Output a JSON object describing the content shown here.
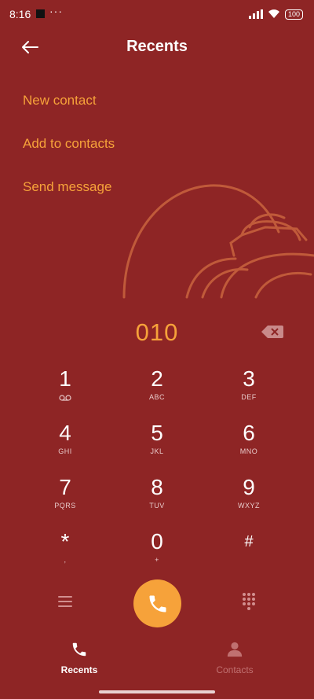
{
  "status_bar": {
    "time": "8:16",
    "dots": "···",
    "battery": "100"
  },
  "header": {
    "title": "Recents"
  },
  "actions": [
    {
      "label": "New contact"
    },
    {
      "label": "Add to contacts"
    },
    {
      "label": "Send message"
    }
  ],
  "dialer": {
    "number": "010",
    "keys": [
      {
        "digit": "1",
        "letters": ""
      },
      {
        "digit": "2",
        "letters": "ABC"
      },
      {
        "digit": "3",
        "letters": "DEF"
      },
      {
        "digit": "4",
        "letters": "GHI"
      },
      {
        "digit": "5",
        "letters": "JKL"
      },
      {
        "digit": "6",
        "letters": "MNO"
      },
      {
        "digit": "7",
        "letters": "PQRS"
      },
      {
        "digit": "8",
        "letters": "TUV"
      },
      {
        "digit": "9",
        "letters": "WXYZ"
      },
      {
        "digit": "*",
        "letters": ","
      },
      {
        "digit": "0",
        "letters": "+"
      },
      {
        "digit": "#",
        "letters": ""
      }
    ]
  },
  "tabs": [
    {
      "label": "Recents",
      "active": true
    },
    {
      "label": "Contacts",
      "active": false
    }
  ],
  "colors": {
    "background": "#8e2525",
    "accent": "#f6a23a"
  }
}
